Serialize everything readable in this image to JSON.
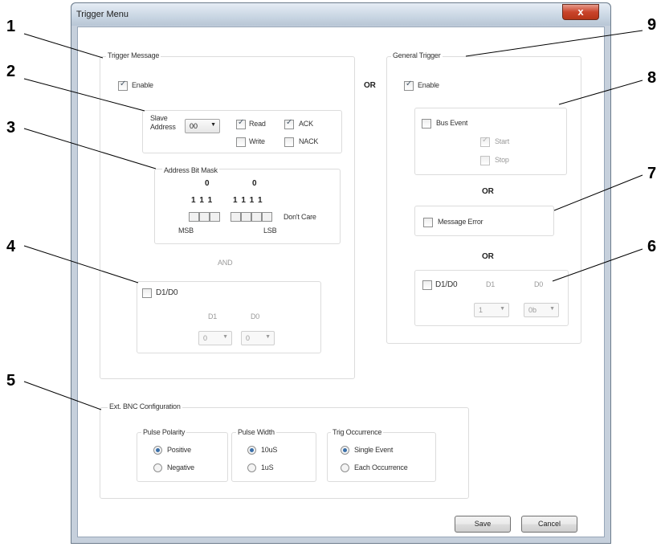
{
  "window": {
    "title": "Trigger Menu",
    "close_label": "x"
  },
  "trigger_message": {
    "group_label": "Trigger Message",
    "enable_label": "Enable",
    "slave_label_1": "Slave",
    "slave_label_2": "Address",
    "slave_value": "00",
    "read_label": "Read",
    "write_label": "Write",
    "ack_label": "ACK",
    "nack_label": "NACK",
    "mask_label": "Address Bit Mask",
    "mask_zero_1": "0",
    "mask_zero_2": "0",
    "mask_ones_1": "1 1 1",
    "mask_ones_2": "1 1 1 1",
    "dont_care": "Don't Care",
    "msb": "MSB",
    "lsb": "LSB",
    "and_label": "AND",
    "d1d0_label": "D1/D0",
    "d1_label": "D1",
    "d0_label": "D0",
    "d1_value": "0",
    "d0_value": "0"
  },
  "or_main": "OR",
  "general_trigger": {
    "group_label": "General Trigger",
    "enable_label": "Enable",
    "bus_event_label": "Bus Event",
    "start_label": "Start",
    "stop_label": "Stop",
    "or_1": "OR",
    "message_error_label": "Message Error",
    "or_2": "OR",
    "d1d0_label": "D1/D0",
    "d1_label": "D1",
    "d0_label": "D0",
    "d1_value": "1",
    "d0_value": "0b"
  },
  "bnc": {
    "group_label": "Ext. BNC Configuration",
    "polarity_label": "Pulse Polarity",
    "positive": "Positive",
    "negative": "Negative",
    "width_label": "Pulse Width",
    "w_10us": "10uS",
    "w_1us": "1uS",
    "occ_label": "Trig Occurrence",
    "single": "Single Event",
    "each": "Each Occurrence"
  },
  "buttons": {
    "save": "Save",
    "cancel": "Cancel"
  },
  "callouts": {
    "n1": "1",
    "n2": "2",
    "n3": "3",
    "n4": "4",
    "n5": "5",
    "n6": "6",
    "n7": "7",
    "n8": "8",
    "n9": "9"
  }
}
